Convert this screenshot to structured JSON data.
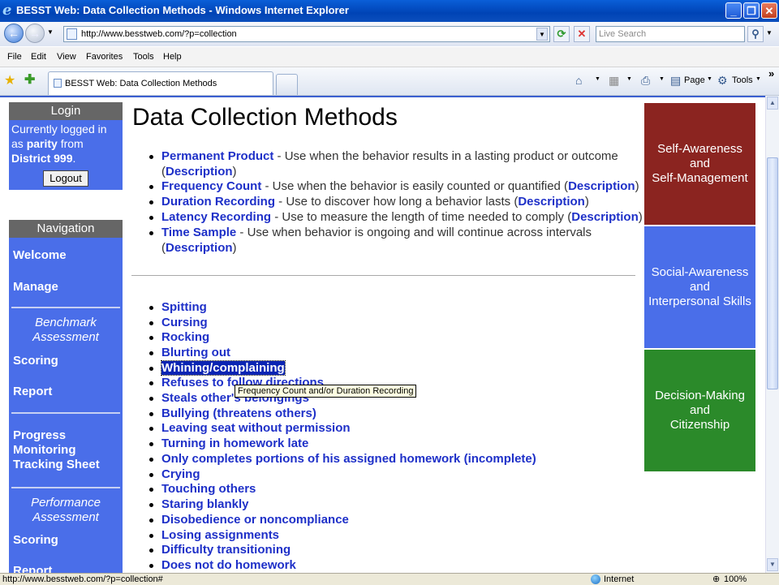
{
  "window": {
    "title": "BESST Web: Data Collection Methods - Windows Internet Explorer",
    "minimize_glyph": "_",
    "maximize_glyph": "❐",
    "close_glyph": "✕"
  },
  "address_bar": {
    "url": "http://www.besstweb.com/?p=collection",
    "search_placeholder": "Live Search"
  },
  "menu": [
    "File",
    "Edit",
    "View",
    "Favorites",
    "Tools",
    "Help"
  ],
  "tabs": {
    "active_label": "BESST Web: Data Collection Methods"
  },
  "command_bar": {
    "page_label": "Page",
    "tools_label": "Tools",
    "more_glyph": "»"
  },
  "login": {
    "header": "Login",
    "line1": "Currently logged in",
    "line2_prefix": "as ",
    "username": "parity",
    "line2_suffix": " from",
    "district": "District 999",
    "district_suffix": ".",
    "logout_label": "Logout"
  },
  "navigation": {
    "header": "Navigation",
    "welcome": "Welcome",
    "manage": "Manage",
    "benchmark_line1": "Benchmark",
    "benchmark_line2": "Assessment",
    "scoring1": "Scoring",
    "report1": "Report",
    "progress_line1": "Progress",
    "progress_line2": "Monitoring",
    "progress_line3": "Tracking Sheet",
    "performance_line1": "Performance",
    "performance_line2": "Assessment",
    "scoring2": "Scoring",
    "report2": "Report"
  },
  "main": {
    "title": "Data Collection Methods",
    "methods": [
      {
        "name": "Permanent Product",
        "text": " - Use when the behavior results in a lasting product or outcome",
        "desc_open": "(",
        "desc": "Description",
        "desc_close": ")"
      },
      {
        "name": "Frequency Count",
        "text": " - Use when the behavior is easily counted or quantified (",
        "desc": "Description",
        "desc_close": ")"
      },
      {
        "name": "Duration Recording",
        "text": " - Use to discover how long a behavior lasts (",
        "desc": "Description",
        "desc_close": ")"
      },
      {
        "name": "Latency Recording",
        "text": " - Use to measure the length of time needed to comply (",
        "desc": "Description",
        "desc_close": ")"
      },
      {
        "name": "Time Sample",
        "text": " - Use when behavior is ongoing and will continue across intervals",
        "desc_open": "(",
        "desc": "Description",
        "desc_close": ")"
      }
    ],
    "behaviors": [
      "Spitting",
      "Cursing",
      "Rocking",
      "Blurting out",
      "Whining/complaining",
      "Refuses to follow directions",
      "Steals other's belongings",
      "Bullying (threatens others)",
      "Leaving seat without permission",
      "Turning in homework late",
      "Only completes portions of his assigned homework (incomplete)",
      "Crying",
      "Touching others",
      "Staring blankly",
      "Disobedience or noncompliance",
      "Losing assignments",
      "Difficulty transitioning",
      "Does not do homework"
    ],
    "tooltip": "Frequency Count and/or Duration Recording"
  },
  "panels": {
    "p1_line1": "Self-Awareness",
    "p1_line2": "and",
    "p1_line3": "Self-Management",
    "p2_line1": "Social-Awareness",
    "p2_line2": "and",
    "p2_line3": "Interpersonal Skills",
    "p3_line1": "Decision-Making",
    "p3_line2": "and",
    "p3_line3": "Citizenship"
  },
  "status_bar": {
    "status_text": "http://www.besstweb.com/?p=collection#",
    "zone": "Internet",
    "zoom": "100%"
  },
  "colors": {
    "nav_blue": "#4a6ee9",
    "link_blue": "#1e30c8",
    "panel_red": "#8b2420",
    "panel_green": "#2b8a2a",
    "header_gray": "#666666"
  }
}
